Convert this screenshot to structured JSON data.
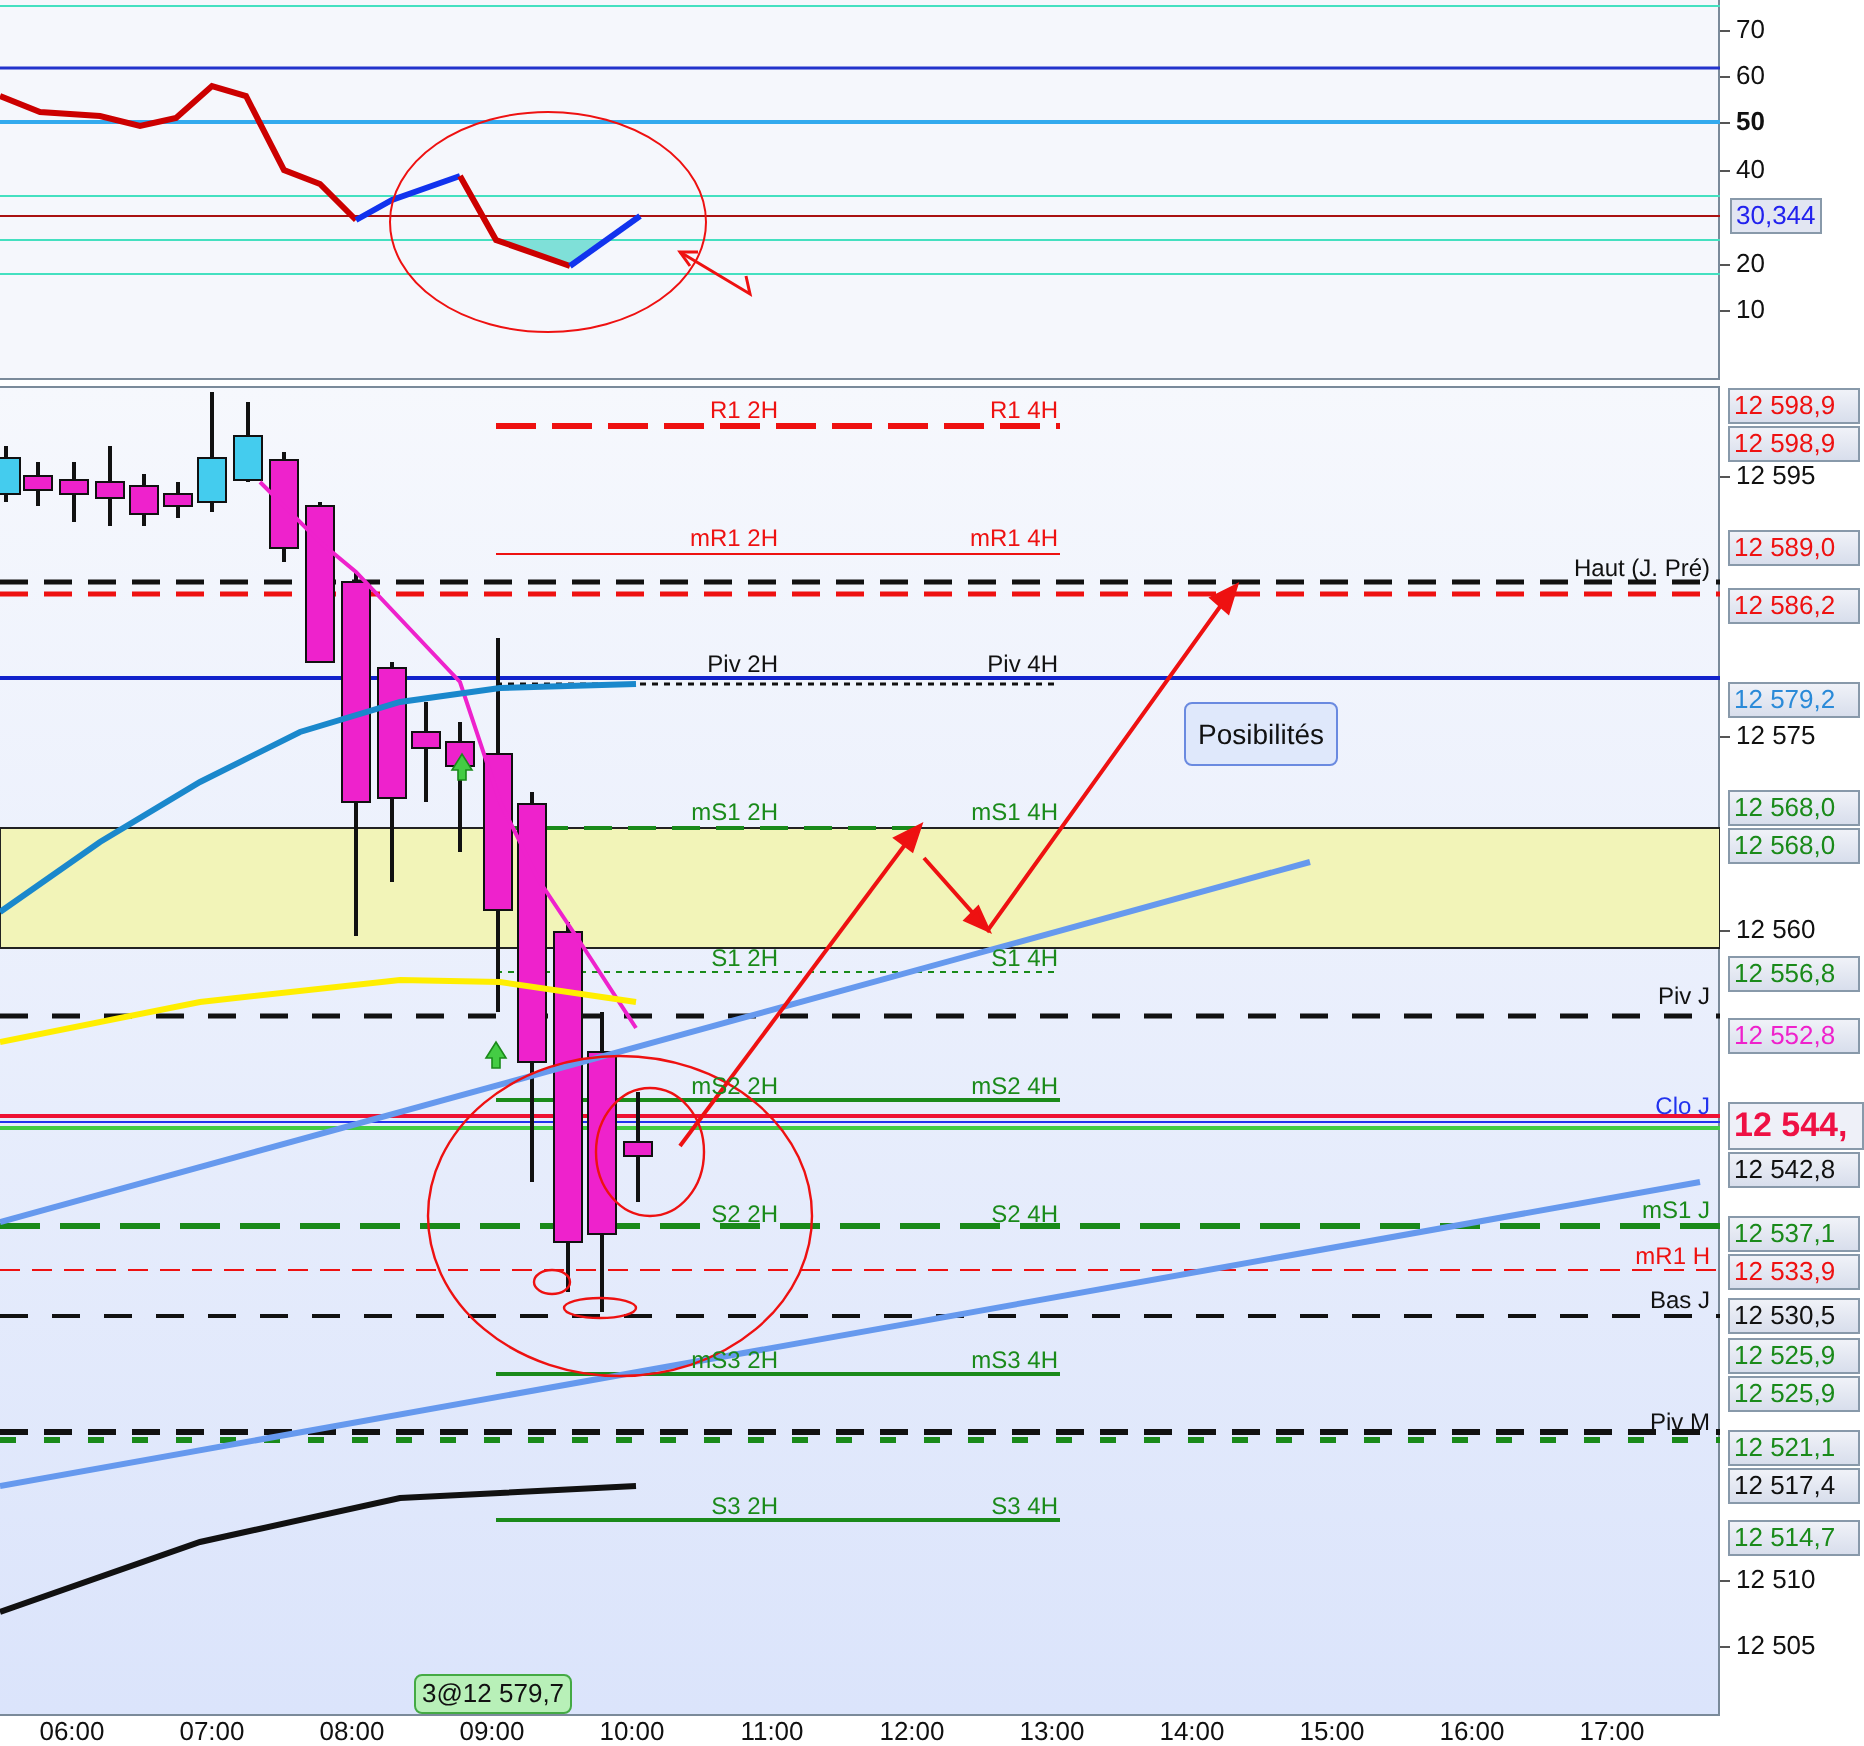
{
  "indicator_pane": {
    "ticks": [
      {
        "label": "70",
        "bold": false
      },
      {
        "label": "60",
        "bold": false
      },
      {
        "label": "50",
        "bold": true
      },
      {
        "label": "40",
        "bold": false
      },
      {
        "label": "20",
        "bold": false
      },
      {
        "label": "10",
        "bold": false
      }
    ],
    "value_tag": {
      "label": "30,344",
      "color": "#2222ee"
    }
  },
  "price_pane": {
    "ticks": [
      "12 595",
      "12 575",
      "12 560",
      "12 510",
      "12 505"
    ],
    "price_tags": [
      {
        "label": "12 598,9",
        "color": "#ee1111",
        "kind": "tag"
      },
      {
        "label": "12 598,9",
        "color": "#ee1111",
        "kind": "tag"
      },
      {
        "label": "12 589,0",
        "color": "#ee1111",
        "kind": "tag"
      },
      {
        "label": "12 586,2",
        "color": "#ee1111",
        "kind": "tag"
      },
      {
        "label": "12 579,2",
        "color": "#2a8ad8",
        "kind": "tag"
      },
      {
        "label": "12 568,0",
        "color": "#1a8a1a",
        "kind": "tag"
      },
      {
        "label": "12 568,0",
        "color": "#1a8a1a",
        "kind": "tag"
      },
      {
        "label": "12 556,8",
        "color": "#1a8a1a",
        "kind": "tag"
      },
      {
        "label": "12 552,8",
        "color": "#ee22cc",
        "kind": "tag"
      },
      {
        "label": "12 544,",
        "color": "#ee1144",
        "kind": "current"
      },
      {
        "label": "12 542,8",
        "color": "#111111",
        "kind": "tag"
      },
      {
        "label": "12 537,1",
        "color": "#1a8a1a",
        "kind": "tag"
      },
      {
        "label": "12 533,9",
        "color": "#ee1111",
        "kind": "tag"
      },
      {
        "label": "12 530,5",
        "color": "#111111",
        "kind": "tag"
      },
      {
        "label": "12 525,9",
        "color": "#1a8a1a",
        "kind": "tag"
      },
      {
        "label": "12 525,9",
        "color": "#1a8a1a",
        "kind": "tag"
      },
      {
        "label": "12 521,1",
        "color": "#1a8a1a",
        "kind": "tag"
      },
      {
        "label": "12 517,4",
        "color": "#111111",
        "kind": "tag"
      },
      {
        "label": "12 514,7",
        "color": "#1a8a1a",
        "kind": "tag"
      }
    ],
    "level_labels": [
      {
        "text": "R1 2H",
        "color": "#ee1111"
      },
      {
        "text": "R1 4H",
        "color": "#ee1111"
      },
      {
        "text": "mR1 2H",
        "color": "#ee1111"
      },
      {
        "text": "mR1 4H",
        "color": "#ee1111"
      },
      {
        "text": "Haut (J. Pré)",
        "color": "#111111"
      },
      {
        "text": "Piv 2H",
        "color": "#111111"
      },
      {
        "text": "Piv 4H",
        "color": "#111111"
      },
      {
        "text": "mS1 2H",
        "color": "#1a8a1a"
      },
      {
        "text": "mS1 4H",
        "color": "#1a8a1a"
      },
      {
        "text": "S1 2H",
        "color": "#1a8a1a"
      },
      {
        "text": "S1 4H",
        "color": "#1a8a1a"
      },
      {
        "text": "Piv J",
        "color": "#111111"
      },
      {
        "text": "mS2 2H",
        "color": "#1a8a1a"
      },
      {
        "text": "mS2 4H",
        "color": "#1a8a1a"
      },
      {
        "text": "Clo J",
        "color": "#2233ee"
      },
      {
        "text": "S2 2H",
        "color": "#1a8a1a"
      },
      {
        "text": "S2 4H",
        "color": "#1a8a1a"
      },
      {
        "text": "mS1 J",
        "color": "#1a8a1a"
      },
      {
        "text": "mR1 H",
        "color": "#ee1111"
      },
      {
        "text": "Bas J",
        "color": "#111111"
      },
      {
        "text": "mS3 2H",
        "color": "#1a8a1a"
      },
      {
        "text": "mS3 4H",
        "color": "#1a8a1a"
      },
      {
        "text": "Piv M",
        "color": "#111111"
      },
      {
        "text": "S3 2H",
        "color": "#1a8a1a"
      },
      {
        "text": "S3 4H",
        "color": "#1a8a1a"
      }
    ],
    "annotation": "Posibilités",
    "order_tag": "3@12 579,7"
  },
  "time_axis": [
    "06:00",
    "07:00",
    "08:00",
    "09:00",
    "10:00",
    "11:00",
    "12:00",
    "13:00",
    "14:00",
    "15:00",
    "16:00",
    "17:00"
  ]
}
